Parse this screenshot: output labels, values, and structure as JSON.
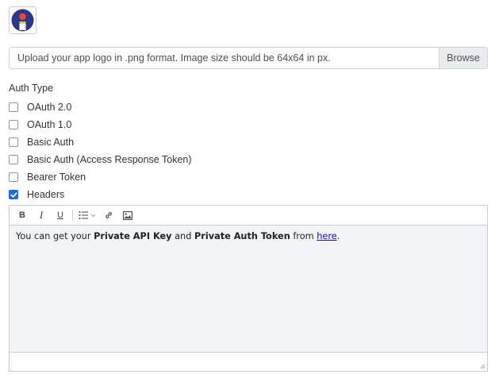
{
  "logo": {
    "icon": "app-logo-icon",
    "colors": {
      "ring": "#2c3787",
      "accent": "#e8453c",
      "bg": "#ffffff"
    }
  },
  "upload": {
    "placeholder": "Upload your app logo in .png format. Image size should be 64x64 in px.",
    "browse_label": "Browse"
  },
  "auth": {
    "label": "Auth Type",
    "options": [
      {
        "label": "OAuth 2.0",
        "checked": false
      },
      {
        "label": "OAuth 1.0",
        "checked": false
      },
      {
        "label": "Basic Auth",
        "checked": false
      },
      {
        "label": "Basic Auth (Access Response Token)",
        "checked": false
      },
      {
        "label": "Bearer Token",
        "checked": false
      },
      {
        "label": "Headers",
        "checked": true
      }
    ]
  },
  "editor": {
    "toolbar": {
      "bold": "B",
      "italic": "I",
      "underline": "U",
      "icons": [
        "bold-icon",
        "italic-icon",
        "underline-icon",
        "bullet-list-icon",
        "link-icon",
        "image-icon"
      ]
    },
    "content": {
      "t1": "You can get your ",
      "b1": "Private API Key",
      "t2": " and ",
      "b2": "Private Auth Token",
      "t3": " from ",
      "link": "here",
      "t4": "."
    }
  },
  "colors": {
    "checkbox_checked": "#1b6fd8",
    "editor_bg": "#f2f5f8",
    "link": "#1a0dab"
  }
}
